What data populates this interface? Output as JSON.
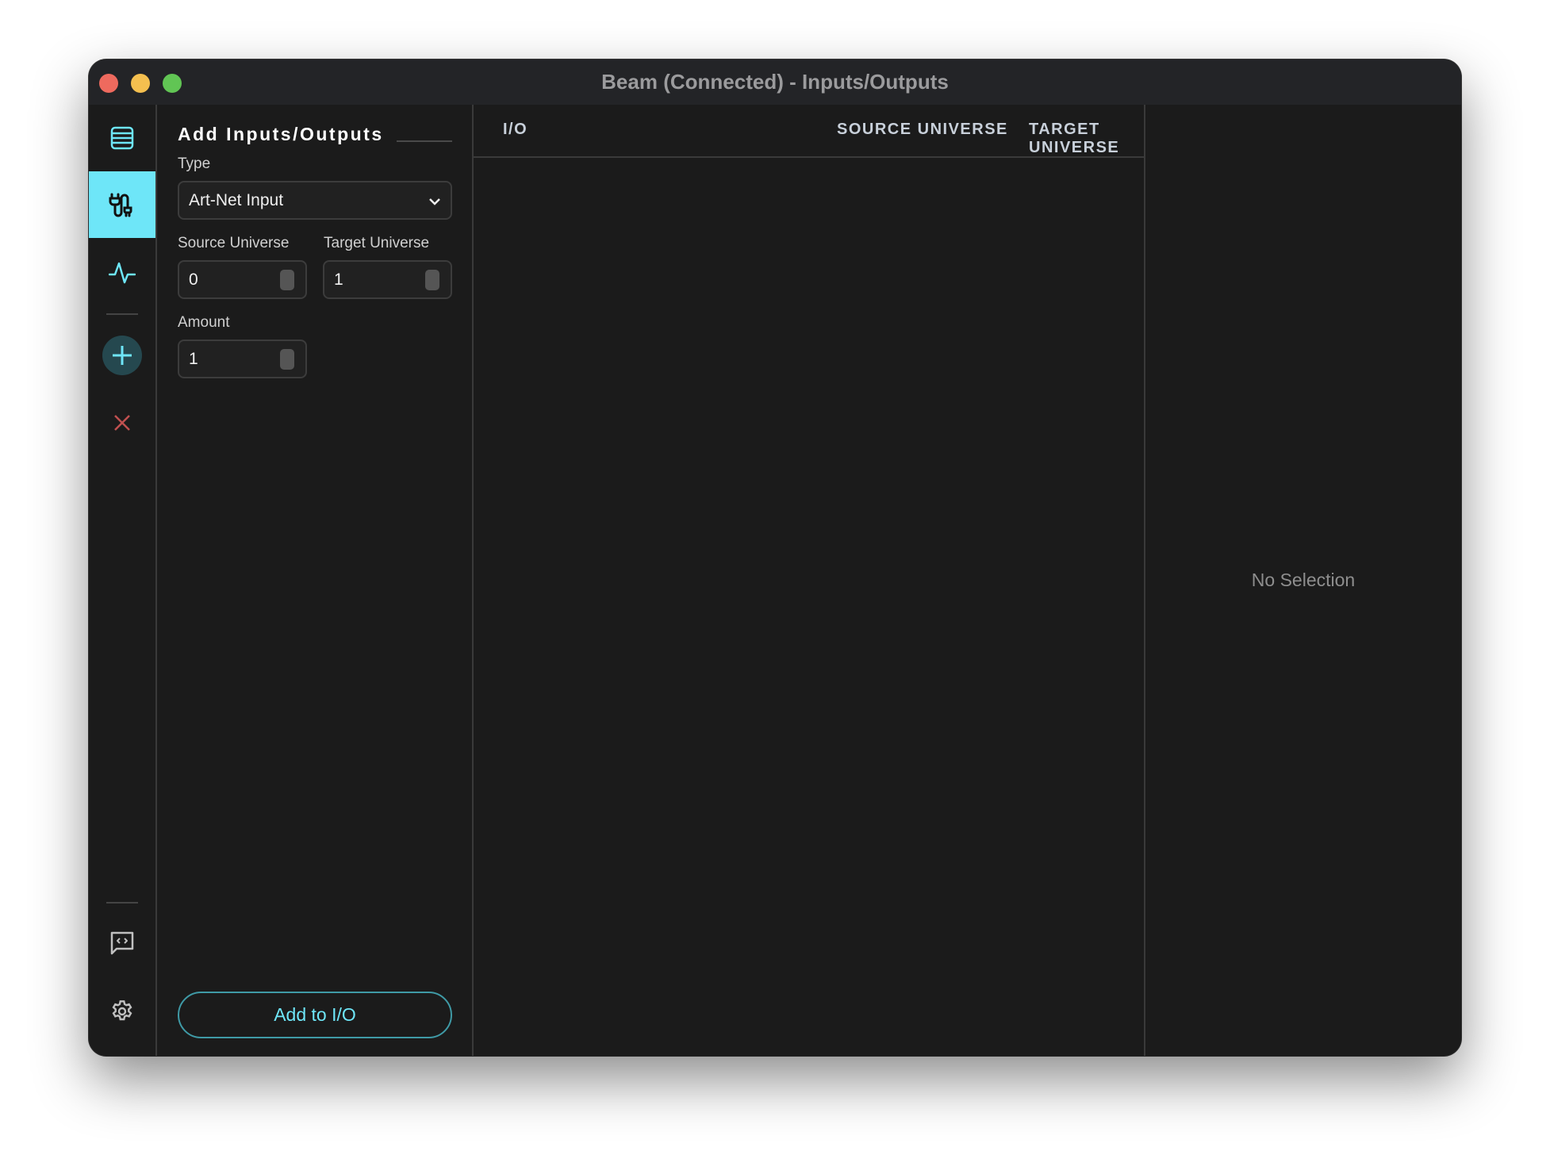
{
  "window": {
    "title": "Beam (Connected) - Inputs/Outputs"
  },
  "sidebar": {
    "items": [
      {
        "icon": "list-icon",
        "active": false
      },
      {
        "icon": "plug-icon",
        "active": true
      },
      {
        "icon": "pulse-icon",
        "active": false
      },
      {
        "icon": "plus-icon",
        "active": false
      },
      {
        "icon": "close-icon",
        "active": false
      },
      {
        "icon": "code-chat-icon",
        "active": false
      },
      {
        "icon": "gear-icon",
        "active": false
      }
    ],
    "accent": "#6ee6f8"
  },
  "panel": {
    "title": "Add Inputs/Outputs",
    "type_label": "Type",
    "type_value": "Art-Net Input",
    "source_label": "Source Universe",
    "source_value": "0",
    "target_label": "Target Universe",
    "target_value": "1",
    "amount_label": "Amount",
    "amount_value": "1",
    "add_button": "Add to I/O"
  },
  "table": {
    "columns": [
      "I/O",
      "SOURCE UNIVERSE",
      "TARGET UNIVERSE"
    ],
    "rows": []
  },
  "detail": {
    "empty_text": "No Selection"
  }
}
